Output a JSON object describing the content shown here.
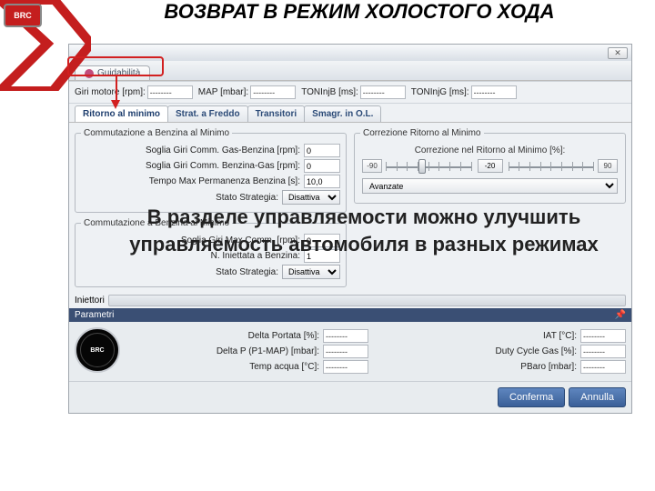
{
  "slide": {
    "title": "ВОЗВРАТ В РЕЖИМ ХОЛОСТОГО ХОДА"
  },
  "logo": "BRC",
  "titlebar": {
    "close": "✕"
  },
  "main_tab": {
    "label": "Guidabilità"
  },
  "header": {
    "giri_label": "Giri motore [rpm]:",
    "giri_val": "--------",
    "map_label": "MAP [mbar]:",
    "map_val": "--------",
    "tonb_label": "TONInjB [ms]:",
    "tonb_val": "--------",
    "tong_label": "TONInjG [ms]:",
    "tong_val": "--------"
  },
  "subtabs": {
    "t1": "Ritorno al minimo",
    "t2": "Strat. a Freddo",
    "t3": "Transitori",
    "t4": "Smagr. in O.L."
  },
  "box1": {
    "legend": "Commutazione a Benzina al Minimo",
    "r1_label": "Soglia Giri Comm. Gas-Benzina [rpm]:",
    "r1_val": "0",
    "r2_label": "Soglia Giri Comm. Benzina-Gas [rpm]:",
    "r2_val": "0",
    "r3_label": "Tempo Max Permanenza Benzina [s]:",
    "r3_val": "10,0",
    "r4_label": "Stato Strategia:",
    "r4_val": "Disattiva"
  },
  "box2": {
    "legend": "Commutazione a Benzina al Minimo",
    "r1_label": "Soglia Giri Max Comm. [rpm]:",
    "r1_val": "0",
    "r2_label": "N. Iniettata a Benzina:",
    "r2_val": "1",
    "r3_label": "Stato Strategia:",
    "r3_val": "Disattiva"
  },
  "box3": {
    "legend": "Correzione Ritorno al Minimo",
    "slider_label": "Correzione nel Ritorno al Minimo [%]:",
    "lo": "-90",
    "val": "-20",
    "hi": "90",
    "adv": "Avanzate"
  },
  "iniettori_label": "Iniettori",
  "param": {
    "title": "Parametri",
    "gauge": "BRC",
    "p1_label": "Delta Portata [%]:",
    "p1_val": "--------",
    "p2_label": "Delta P (P1-MAP) [mbar]:",
    "p2_val": "--------",
    "p3_label": "Temp acqua [°C]:",
    "p3_val": "--------",
    "p4_label": "IAT [°C]:",
    "p4_val": "--------",
    "p5_label": "Duty Cycle Gas [%]:",
    "p5_val": "--------",
    "p6_label": "PBaro [mbar]:",
    "p6_val": "--------",
    "pin": "📌"
  },
  "footer": {
    "ok": "Conferma",
    "cancel": "Annulla"
  },
  "overlay": "В разделе управляемости можно улучшить управляемость автомобиля в разных режимах"
}
